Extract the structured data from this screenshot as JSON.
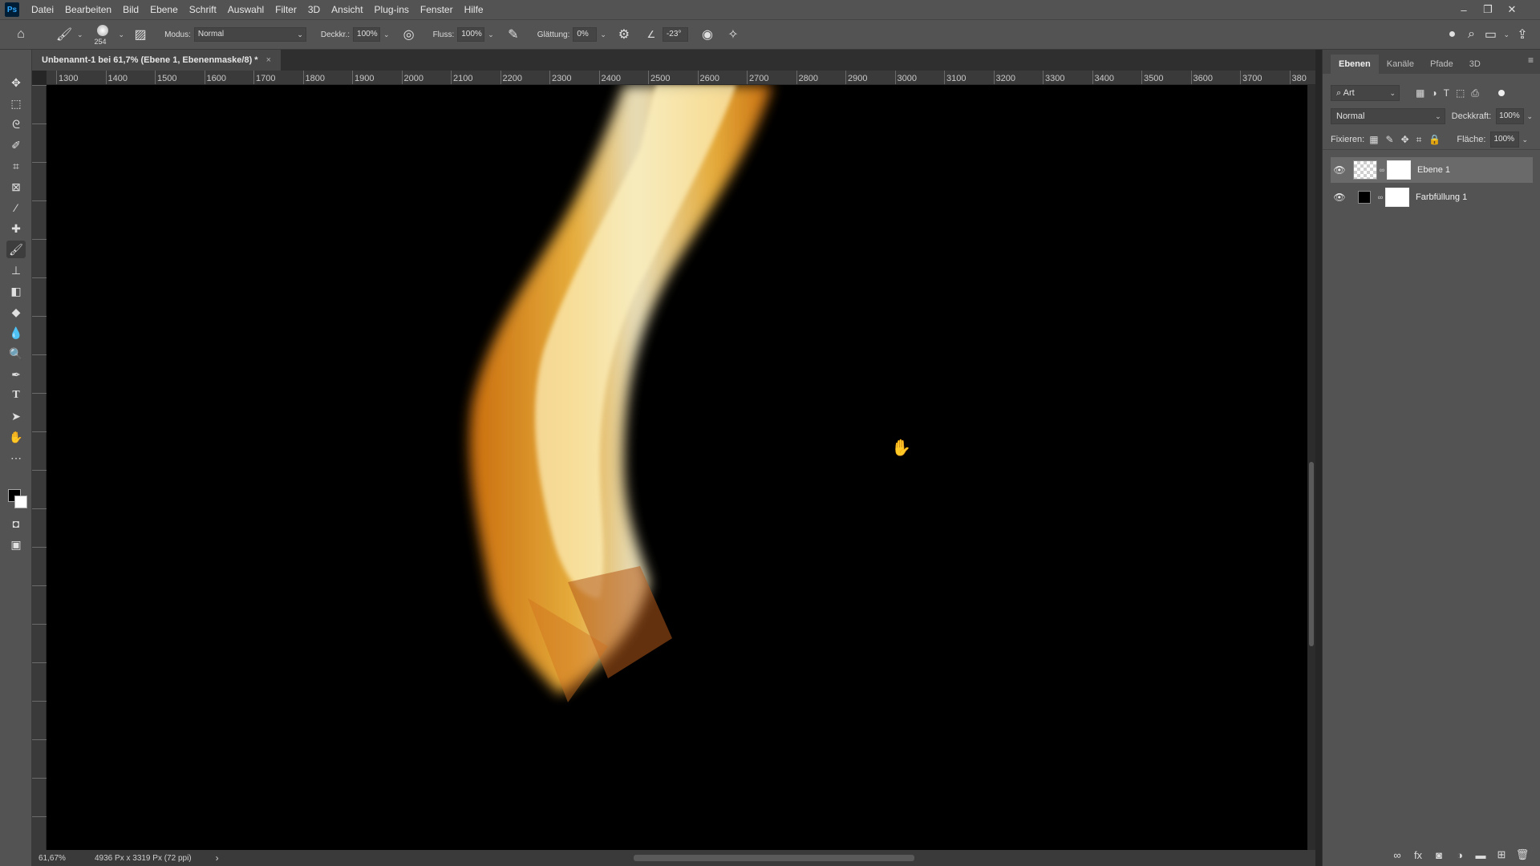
{
  "app": {
    "logo": "Ps"
  },
  "menu": [
    "Datei",
    "Bearbeiten",
    "Bild",
    "Ebene",
    "Schrift",
    "Auswahl",
    "Filter",
    "3D",
    "Ansicht",
    "Plug-ins",
    "Fenster",
    "Hilfe"
  ],
  "window_controls": {
    "minimize": "–",
    "restore": "❐",
    "close": "✕"
  },
  "options": {
    "brush_size": "254",
    "modus_label": "Modus:",
    "modus_value": "Normal",
    "deckkraft_label": "Deckkr.:",
    "deckkraft_value": "100%",
    "fluss_label": "Fluss:",
    "fluss_value": "100%",
    "glaettung_label": "Glättung:",
    "glaettung_value": "0%",
    "angle_value": "-23°"
  },
  "document": {
    "tab_title": "Unbenannt-1 bei 61,7% (Ebene 1, Ebenenmaske/8) *",
    "close": "×"
  },
  "ruler_top": [
    "1300",
    "1400",
    "1500",
    "1600",
    "1700",
    "1800",
    "1900",
    "2000",
    "2100",
    "2200",
    "2300",
    "2400",
    "2500",
    "2600",
    "2700",
    "2800",
    "2900",
    "3000",
    "3100",
    "3200",
    "3300",
    "3400",
    "3500",
    "3600",
    "3700",
    "380"
  ],
  "status": {
    "zoom": "61,67%",
    "doc_info": "4936 Px x 3319 Px (72 ppi)",
    "arrow": "›"
  },
  "panel": {
    "tabs": [
      "Ebenen",
      "Kanäle",
      "Pfade",
      "3D"
    ],
    "filter_value": "Art",
    "blend_mode": "Normal",
    "deckkraft_label": "Deckkraft:",
    "deckkraft_value": "100%",
    "fixieren_label": "Fixieren:",
    "flaeche_label": "Fläche:",
    "flaeche_value": "100%",
    "layers": [
      {
        "name": "Ebene 1"
      },
      {
        "name": "Farbfüllung 1"
      }
    ]
  },
  "colors": {
    "flame_core": "#fff6d0",
    "flame_mid": "#ffc043",
    "flame_edge": "#e07a10"
  }
}
